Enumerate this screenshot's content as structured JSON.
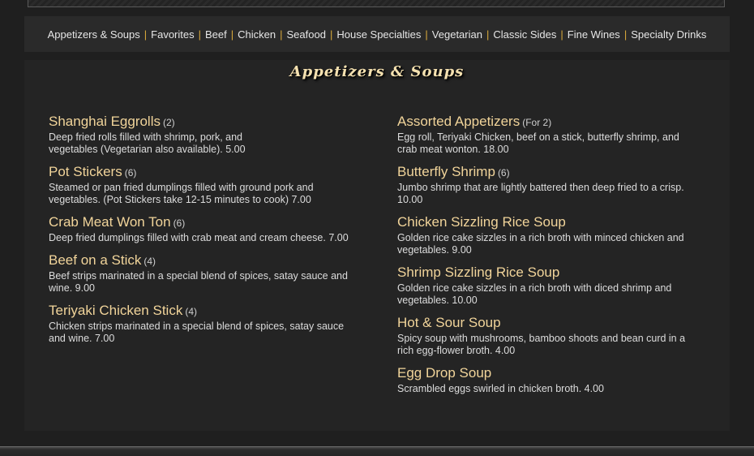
{
  "nav": {
    "items": [
      "Appetizers & Soups",
      "Favorites",
      "Beef",
      "Chicken",
      "Seafood",
      "House Specialties",
      "Vegetarian",
      "Classic Sides",
      "Fine Wines",
      "Specialty Drinks"
    ],
    "separator": "|"
  },
  "section": {
    "title": "Appetizers & Soups"
  },
  "left_items": [
    {
      "name": "Shanghai Eggrolls",
      "qty": "(2)",
      "desc": "Deep fried rolls filled with shrimp, pork, and vegetables (Vegetarian also available). 5.00"
    },
    {
      "name": "Pot Stickers",
      "qty": "(6)",
      "desc": "Steamed or pan fried dumplings filled with ground pork and vegetables. (Pot Stickers take 12-15 minutes to cook) 7.00"
    },
    {
      "name": "Crab Meat Won Ton",
      "qty": "(6)",
      "desc": "Deep fried dumplings filled with crab meat and cream cheese. 7.00"
    },
    {
      "name": "Beef on a Stick",
      "qty": "(4)",
      "desc": "Beef strips marinated in a special blend of spices, satay sauce and wine. 9.00"
    },
    {
      "name": "Teriyaki Chicken Stick",
      "qty": "(4)",
      "desc": "Chicken strips marinated in a special blend of spices, satay sauce and wine. 7.00"
    }
  ],
  "right_items": [
    {
      "name": "Assorted Appetizers",
      "qty": "(For 2)",
      "desc": "Egg roll, Teriyaki Chicken, beef on a stick, butterfly shrimp, and crab meat wonton. 18.00"
    },
    {
      "name": "Butterfly Shrimp",
      "qty": "(6)",
      "desc": "Jumbo shrimp that are lightly battered then deep fried to a crisp. 10.00"
    },
    {
      "name": "Chicken Sizzling Rice Soup",
      "qty": "",
      "desc": "Golden rice cake sizzles in a rich broth with minced chicken and vegetables. 9.00"
    },
    {
      "name": "Shrimp Sizzling Rice Soup",
      "qty": "",
      "desc": "Golden rice cake sizzles in a rich broth with diced shrimp and vegetables. 10.00"
    },
    {
      "name": "Hot & Sour Soup",
      "qty": "",
      "desc": "Spicy soup with mushrooms, bamboo shoots and bean curd in a rich egg-flower broth. 4.00"
    },
    {
      "name": "Egg Drop Soup",
      "qty": "",
      "desc": "Scrambled eggs swirled in chicken broth. 4.00"
    }
  ],
  "colors": {
    "accent": "#d9a93a",
    "item_name": "#f1d49a",
    "panel": "#242424"
  }
}
